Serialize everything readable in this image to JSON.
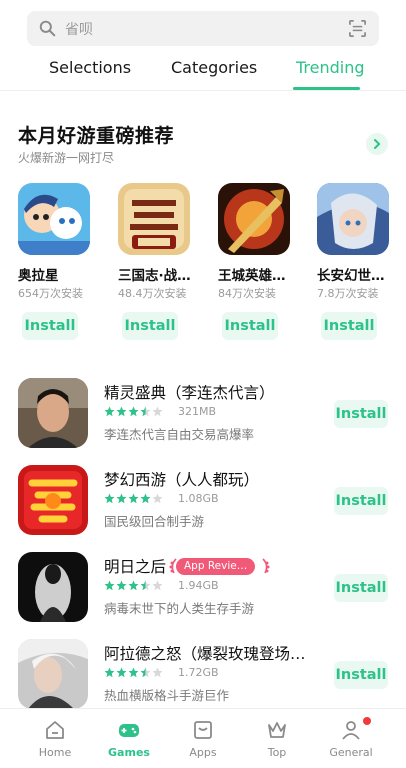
{
  "search": {
    "placeholder": "省呗"
  },
  "tabs": [
    {
      "label": "Selections"
    },
    {
      "label": "Categories"
    },
    {
      "label": "Trending",
      "selected": true
    }
  ],
  "featured": {
    "title": "本月好游重磅推荐",
    "subtitle": "火爆新游一网打尽",
    "apps": [
      {
        "name": "奥拉星",
        "downloads": "654万次安装",
        "install_label": "Install"
      },
      {
        "name": "三国志·战…",
        "downloads": "48.4万次安装",
        "install_label": "Install"
      },
      {
        "name": "王城英雄…",
        "downloads": "84万次安装",
        "install_label": "Install"
      },
      {
        "name": "长安幻世…",
        "downloads": "7.8万次安装",
        "install_label": "Install"
      }
    ]
  },
  "list": [
    {
      "title": "精灵盛典（李连杰代言）",
      "rating": 3.5,
      "size": "321MB",
      "desc": "李连杰代言自由交易高爆率",
      "install_label": "Install"
    },
    {
      "title": "梦幻西游（人人都玩）",
      "rating": 4,
      "size": "1.08GB",
      "desc": "国民级回合制手游",
      "install_label": "Install"
    },
    {
      "title": "明日之后",
      "badge": "App Revie…",
      "rating": 3.5,
      "size": "1.94GB",
      "desc": "病毒末世下的人类生存手游",
      "install_label": "Install"
    },
    {
      "title": "阿拉德之怒（爆裂玫瑰登场…",
      "rating": 3.5,
      "size": "1.72GB",
      "desc": "热血横版格斗手游巨作",
      "install_label": "Install"
    }
  ],
  "bottom_nav": [
    {
      "label": "Home",
      "icon": "home-icon"
    },
    {
      "label": "Games",
      "icon": "gamepad-icon",
      "selected": true
    },
    {
      "label": "Apps",
      "icon": "apps-icon"
    },
    {
      "label": "Top",
      "icon": "crown-icon"
    },
    {
      "label": "General",
      "icon": "person-icon",
      "notification": true
    }
  ],
  "colors": {
    "accent": "#2cc28a",
    "star": "#2cc28a",
    "badge": "#f05a78"
  }
}
